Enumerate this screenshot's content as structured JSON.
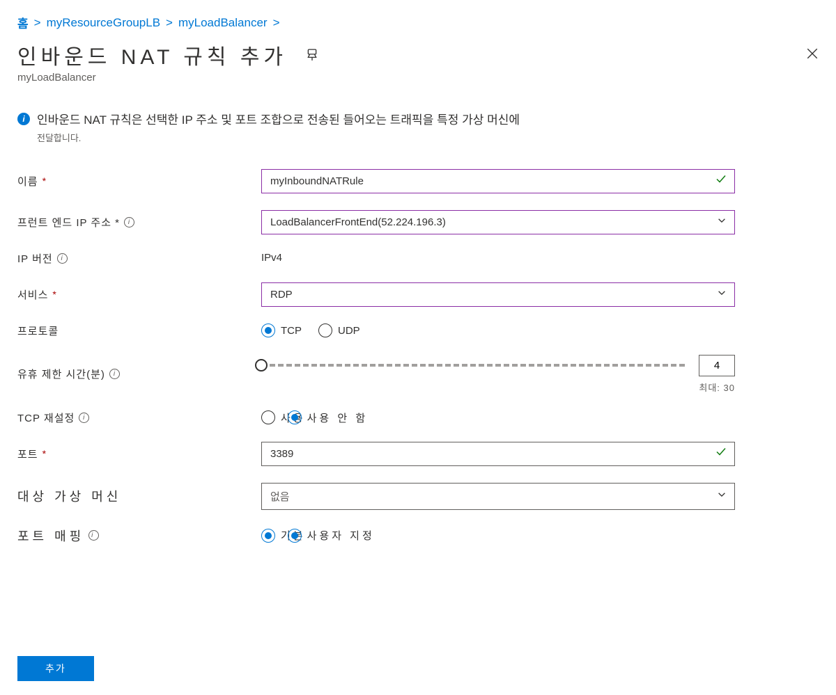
{
  "breadcrumb": {
    "home": "홈",
    "resourceGroup": "myResourceGroupLB",
    "loadBalancer": "myLoadBalancer"
  },
  "header": {
    "title": "인바운드 NAT 규칙 추가",
    "subtitle": "myLoadBalancer"
  },
  "info": {
    "line1": "인바운드 NAT 규칙은 선택한 IP 주소 및 포트 조합으로 전송된 들어오는 트래픽을 특정 가상 머신에",
    "line2": "전달합니다."
  },
  "form": {
    "name": {
      "label": "이름",
      "value": "myInboundNATRule"
    },
    "frontendIp": {
      "label": "프런트 엔드 IP 주소 *",
      "value": "LoadBalancerFrontEnd(52.224.196.3)"
    },
    "ipVersion": {
      "label": "IP 버전",
      "value": "IPv4"
    },
    "service": {
      "label": "서비스",
      "value": "RDP"
    },
    "protocol": {
      "label": "프로토콜",
      "tcp": "TCP",
      "udp": "UDP"
    },
    "idleTimeout": {
      "label": "유휴 제한 시간(분)",
      "value": "4",
      "maxLabel": "최대: 30"
    },
    "tcpReset": {
      "label": "TCP 재설정",
      "enable": "사용",
      "disable": "사용 안 함"
    },
    "port": {
      "label": "포트",
      "value": "3389"
    },
    "targetVm": {
      "label": "대상 가상 머신",
      "value": "없음"
    },
    "portMapping": {
      "label": "포트 매핑",
      "default": "기본",
      "custom": "사용자 지정"
    }
  },
  "footer": {
    "addButton": "추가"
  }
}
